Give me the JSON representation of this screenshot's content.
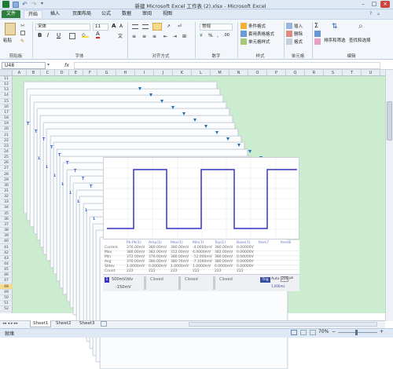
{
  "window": {
    "title": "新建 Microsoft Excel 工作表 (2).xlsx - Microsoft Excel"
  },
  "ribbon_tabs": [
    "文件",
    "开始",
    "插入",
    "页面布局",
    "公式",
    "数据",
    "审阅",
    "视图"
  ],
  "ribbon": {
    "clipboard": {
      "paste_label": "粘贴",
      "group_label": "剪贴板"
    },
    "font": {
      "font_name": "宋体",
      "font_size": "11",
      "group_label": "字体",
      "bold": "B",
      "italic": "I",
      "underline": "U",
      "grow": "A",
      "shrink": "A"
    },
    "alignment": {
      "group_label": "对齐方式"
    },
    "number": {
      "format": "常规",
      "group_label": "数字"
    },
    "styles": {
      "conditional": "条件格式",
      "table_format": "套用表格格式",
      "cell_styles": "单元格样式",
      "group_label": "样式"
    },
    "cells": {
      "insert": "插入",
      "delete": "删除",
      "format": "格式",
      "group_label": "单元格"
    },
    "editing": {
      "sort_filter": "排序和筛选",
      "find_select": "查找和选择",
      "group_label": "编辑",
      "sigma": "Σ"
    }
  },
  "formula_bar": {
    "name_box": "U48",
    "fx": "fx",
    "formula": ""
  },
  "columns": [
    "A",
    "B",
    "C",
    "D",
    "E",
    "F",
    "G",
    "H",
    "I",
    "J",
    "K",
    "L",
    "M",
    "N",
    "O",
    "P",
    "Q",
    "R",
    "S",
    "T",
    "U"
  ],
  "rows": [
    "11",
    "12",
    "13",
    "14",
    "15",
    "16",
    "17",
    "18",
    "19",
    "20",
    "21",
    "22",
    "23",
    "24",
    "25",
    "26",
    "27",
    "28",
    "29",
    "30",
    "31",
    "32",
    "33",
    "34",
    "35",
    "36",
    "37",
    "38",
    "39",
    "40",
    "41",
    "42",
    "43",
    "44",
    "45",
    "46",
    "47",
    "48",
    "49",
    "50",
    "51",
    "52"
  ],
  "scope": {
    "marker_labels": [
      "T",
      "T",
      "T",
      "T",
      "T",
      "T",
      "T",
      "T",
      "T"
    ],
    "channel_marks": [
      "1",
      "1",
      "1",
      "1",
      "1",
      "1",
      "1",
      "1"
    ],
    "measure_headers": [
      "Pk-Pk(1)",
      "Amp(1)",
      "Max(1)",
      "Min(1)",
      "Top(1)",
      "Base(1)",
      "Item7",
      "Item8"
    ],
    "measure_rows": [
      {
        "label": "Current",
        "values": [
          "376.00mV",
          "380.00mV",
          "380.00mV",
          "-4.0000mV",
          "380.00mV",
          "0.00000V",
          "",
          ""
        ]
      },
      {
        "label": "Max",
        "values": [
          "380.00mV",
          "382.00mV",
          "312.00mV",
          "4.0000mV",
          "382.00mV",
          "0.00000V",
          "",
          ""
        ]
      },
      {
        "label": "Min",
        "values": [
          "372.00mV",
          "376.00mV",
          "380.00mV",
          "-12.000mV",
          "380.00mV",
          "0.00000V",
          "",
          ""
        ]
      },
      {
        "label": "Avg",
        "values": [
          "376.00mV",
          "380.00mV",
          "380.76mV",
          "-7.1000mV",
          "380.00mV",
          "0.00000V",
          "",
          ""
        ]
      },
      {
        "label": "Stdev",
        "values": [
          "1.0000mV",
          "0.0000mV",
          "1.0000mV",
          "1.0000mV",
          "0.0000mV",
          "0.00000V",
          "",
          ""
        ]
      },
      {
        "label": "Count",
        "values": [
          "222",
          "222",
          "222",
          "222",
          "222",
          "222",
          "",
          ""
        ]
      }
    ],
    "controls": {
      "ch1_scale": "500mV/div",
      "ch1_offset": "-150mV",
      "closed_labels": [
        "Closed",
        "Closed",
        "Closed"
      ],
      "trig_label": "Trig",
      "trig_mode": "Auto",
      "trig_level": "200",
      "trig_unit": "µs",
      "time_info": [
        "T: 0.00ms",
        "F: 1.00kHz",
        "1.000ms",
        "Norm",
        "4.0000ms"
      ]
    }
  },
  "sheet_tabs": [
    "Sheet1",
    "Sheet2",
    "Sheet3"
  ],
  "status": {
    "ready": "就绪",
    "zoom": "70%"
  },
  "colors": {
    "file_tab": "#2c7f3c",
    "sheet_bg": "#ccecd0",
    "waveform": "#3535c8",
    "marker": "#1f6fb5"
  }
}
